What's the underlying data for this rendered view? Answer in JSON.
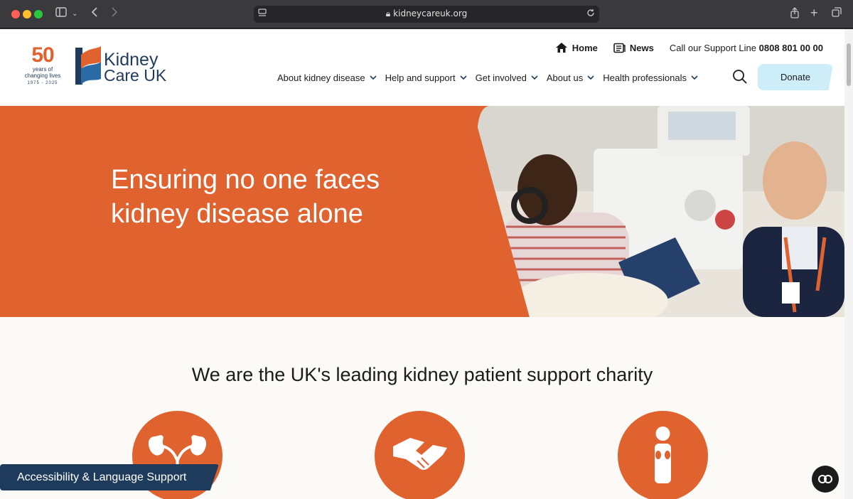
{
  "browser": {
    "url": "kidneycareuk.org"
  },
  "header": {
    "anniversary": {
      "number": "50",
      "line1": "years of",
      "line2": "changing lives",
      "years": "1975 - 2025"
    },
    "brand": {
      "line1": "Kidney",
      "line2": "Care UK"
    },
    "utility": {
      "home": "Home",
      "news": "News",
      "support_prefix": "Call our Support Line",
      "support_number": "0808 801 00 00"
    },
    "nav": [
      {
        "label": "About kidney disease"
      },
      {
        "label": "Help and support"
      },
      {
        "label": "Get involved"
      },
      {
        "label": "About us"
      },
      {
        "label": "Health professionals"
      }
    ],
    "donate": "Donate"
  },
  "hero": {
    "title": "Ensuring no one faces kidney disease alone"
  },
  "section": {
    "title": "We are the UK's leading kidney patient support charity"
  },
  "floating": {
    "a11y": "Accessibility & Language Support"
  },
  "colors": {
    "orange": "#e0622f",
    "navy": "#1f3b5c",
    "donate_bg": "#cdeef9",
    "cream": "#fbfaf6"
  }
}
